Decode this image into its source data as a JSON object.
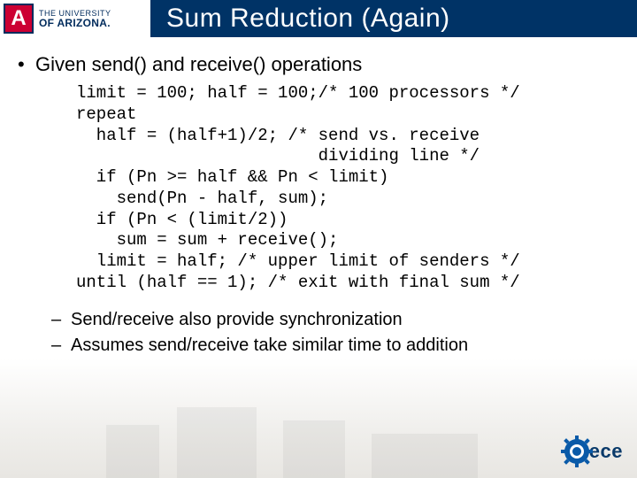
{
  "logo": {
    "letter": "A",
    "line1": "THE UNIVERSITY",
    "line2": "OF ARIZONA."
  },
  "title": "Sum Reduction (Again)",
  "bullet_main": "Given send() and receive() operations",
  "code": "limit = 100; half = 100;/* 100 processors */\nrepeat\n  half = (half+1)/2; /* send vs. receive\n                        dividing line */\n  if (Pn >= half && Pn < limit)\n    send(Pn - half, sum);\n  if (Pn < (limit/2))\n    sum = sum + receive();\n  limit = half; /* upper limit of senders */\nuntil (half == 1); /* exit with final sum */",
  "sub1": "Send/receive also provide synchronization",
  "sub2": "Assumes send/receive take similar time to addition",
  "footer": {
    "ece": "ece"
  }
}
